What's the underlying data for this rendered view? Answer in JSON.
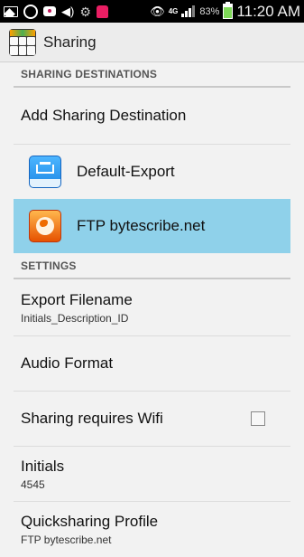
{
  "status_bar": {
    "battery_percent": "83%",
    "time": "11:20 AM",
    "network_label": "4G",
    "icons": [
      "picture-icon",
      "ring-icon",
      "chat-bubble-icon",
      "volume-icon",
      "gear-icon",
      "app-icon",
      "eye-icon",
      "network-icon",
      "signal-icon",
      "battery-icon"
    ]
  },
  "action_bar": {
    "title": "Sharing"
  },
  "sections": {
    "destinations_header": "SHARING DESTINATIONS",
    "add_destination": "Add Sharing Destination",
    "destinations": [
      {
        "label": "Default-Export",
        "icon": "export-icon",
        "selected": false
      },
      {
        "label": "FTP bytescribe.net",
        "icon": "ftp-globe-icon",
        "selected": true
      }
    ],
    "settings_header": "SETTINGS",
    "settings": {
      "export_filename": {
        "title": "Export Filename",
        "value": "Initials_Description_ID"
      },
      "audio_format": {
        "title": "Audio Format"
      },
      "sharing_requires_wifi": {
        "title": "Sharing requires Wifi",
        "checked": false
      },
      "initials": {
        "title": "Initials",
        "value": "4545"
      },
      "quicksharing_profile": {
        "title": "Quicksharing Profile",
        "value": "FTP bytescribe.net"
      }
    }
  },
  "colors": {
    "selected_row": "#8fd1ea",
    "battery_green": "#7ed957"
  }
}
